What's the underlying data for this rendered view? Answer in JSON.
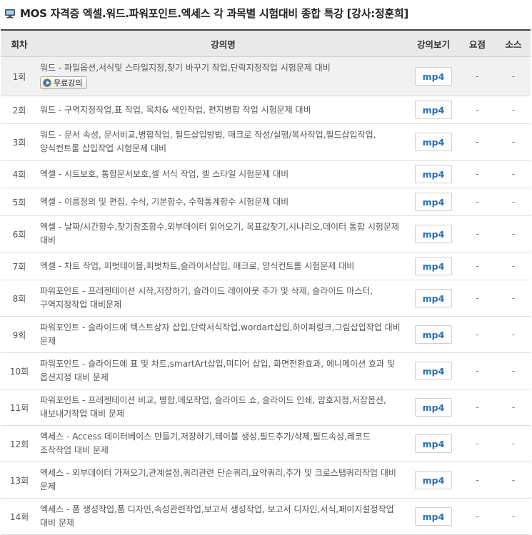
{
  "page": {
    "title": "MOS 자격증 엑셀.워드.파워포인트.엑세스 각 과목별 시험대비 종합 특강 [강사:정훈희]",
    "title_icon": "monitor-icon"
  },
  "table": {
    "headers": {
      "no": "회차",
      "title": "강의명",
      "watch": "강의보기",
      "summary": "요점",
      "source": "소스"
    },
    "free_label": "무료강의",
    "watch_label": "mp4",
    "dash": "-",
    "rows": [
      {
        "no": "1회",
        "title": "워드 - 파일옵션,서식및 스타일지정,찾기 바꾸기 작업,단락지정작업 시험문제 대비",
        "free": true
      },
      {
        "no": "2회",
        "title": "워드 - 구역지정작업,표 작업, 목차& 색인작업, 편지병합 작업 시험문제 대비"
      },
      {
        "no": "3회",
        "title": "워드 - 문서 속성, 문서비교,병합작업, 필드삽입방법, 매크로 작성/실행/복사작업,필드삽입작업, 양식컨트롤 삽입작업 시험문제 대비"
      },
      {
        "no": "4회",
        "title": "엑셀 - 시트보호, 통합문서보호,셀 서식 작업, 셀 스타일 시험문제 대비"
      },
      {
        "no": "5회",
        "title": "엑셀 - 이름정의 및 편집, 수식, 기본함수, 수학통계함수 시험문제 대비"
      },
      {
        "no": "6회",
        "title": "엑셀 - 날짜/시간함수,찾기참조함수,외부데이터 읽어오기, 목표값찾기,시나리오,데이터 통합 시험문제 대비"
      },
      {
        "no": "7회",
        "title": "엑셀 - 차트 작업, 피벗테이블,피벗차트,슬라이서삽입, 매크로, 양식컨트롤 시험문제 대비"
      },
      {
        "no": "8회",
        "title": "파워포인트 - 프레젠테이션 시작,저장하기, 슬라이드 레이아웃 추가 및 삭제, 슬라이드 마스터, 구역지정작업 대비문제"
      },
      {
        "no": "9회",
        "title": "파워포인트 - 슬라이드에 텍스트상자 삽입,단락서식작업,wordart삽입,하이퍼링크,그림삽입작업 대비 문제"
      },
      {
        "no": "10회",
        "title": "파워포인트 - 슬라이드에 표 및 차트,smartArt삽입,미디어 삽입, 화면전환효과, 에니메이션 효과 및 옵션지정 대비 문제"
      },
      {
        "no": "11회",
        "title": "파워포인트 - 프레젠테이션 비교, 병합,메모작업, 슬라이드 쇼, 슬라이드 인쇄, 암호지정,저장옵션,내보내기작업 대비 문제"
      },
      {
        "no": "12회",
        "title": "엑세스 - Access 데이터베이스 만들기,저장하기,테이블 생성,필드추가/삭제,필드속성,레코드 조작작업 대비 문제"
      },
      {
        "no": "13회",
        "title": "엑세스 - 외부데이터 가져오기,관계설정,쿼리관련 단순쿼리,요약쿼리,추가 및 크로스탭쿼리작업 대비 문제"
      },
      {
        "no": "14회",
        "title": "엑세스 - 폼 생성작업,폼 디자인,속성관련작업,보고서 생성작업, 보고서 디자인,서식,페이지설정작업 대비 문제"
      }
    ]
  }
}
